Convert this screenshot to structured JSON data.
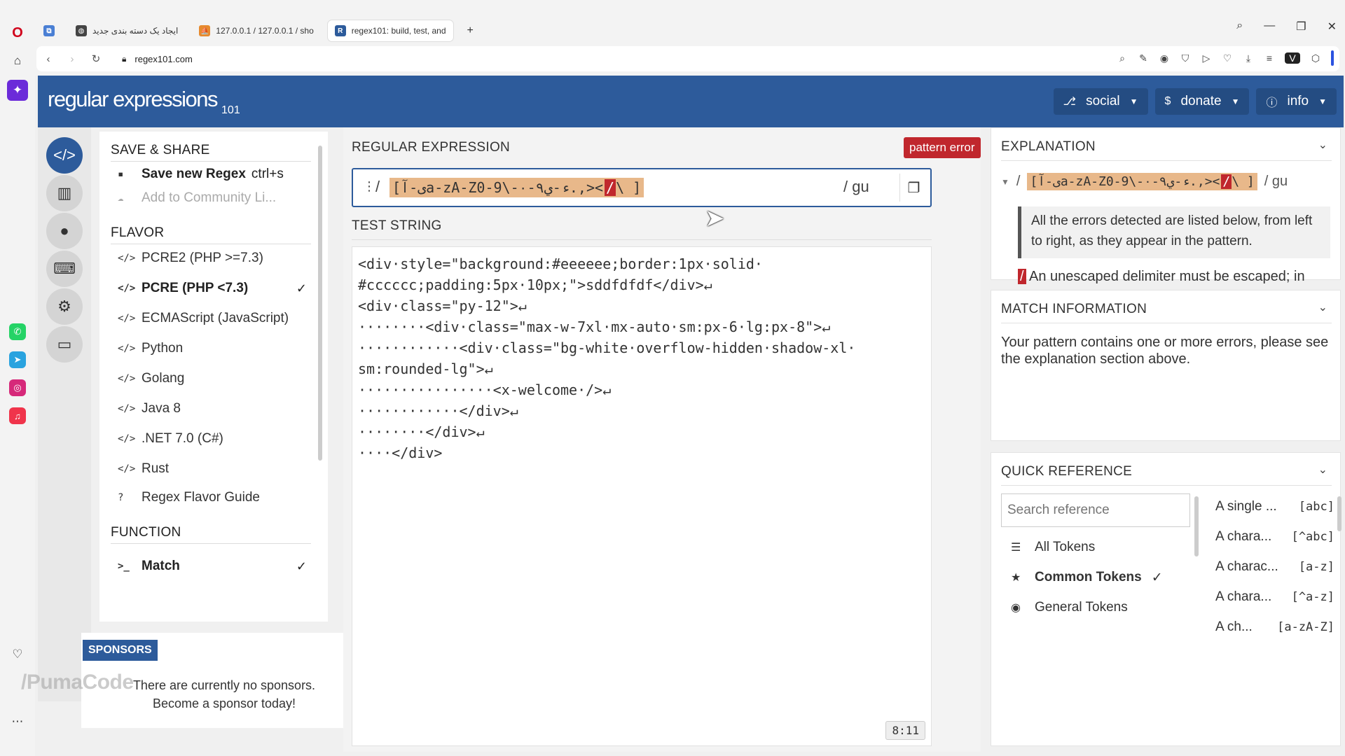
{
  "browser": {
    "tabs": [
      {
        "title": "ایجاد یک دسته بندی جدید",
        "favicon": "globe-icon"
      },
      {
        "title": "127.0.0.1 / 127.0.0.1 / sho",
        "favicon": "phpmyadmin-icon"
      },
      {
        "title": "regex101: build, test, and",
        "favicon": "regex101-icon",
        "active": true
      }
    ],
    "new_tab": "+",
    "url": "regex101.com"
  },
  "header": {
    "logo": "regular expressions",
    "logo_sub": "101",
    "menu": [
      {
        "label": "social",
        "icon": "share-icon"
      },
      {
        "label": "donate",
        "icon": "dollar-icon"
      },
      {
        "label": "info",
        "icon": "info-icon"
      }
    ]
  },
  "left": {
    "save_share_title": "SAVE & SHARE",
    "save_new": "Save new Regex",
    "save_shortcut": "ctrl+s",
    "add_community": "Add to Community Li...",
    "flavor_title": "FLAVOR",
    "flavors": [
      "PCRE2 (PHP >=7.3)",
      "PCRE (PHP <7.3)",
      "ECMAScript (JavaScript)",
      "Python",
      "Golang",
      "Java 8",
      ".NET 7.0 (C#)",
      "Rust"
    ],
    "selected_flavor": "PCRE (PHP <7.3)",
    "flavor_guide": "Regex Flavor Guide",
    "function_title": "FUNCTION",
    "function_match": "Match"
  },
  "sponsors": {
    "tag": "SPONSORS",
    "line1": "There are currently no sponsors.",
    "line2": "Become a sponsor today!"
  },
  "regex": {
    "label": "REGULAR EXPRESSION",
    "error_badge": "pattern error",
    "delimiter": "/",
    "pattern_main": "[ی-آa-zA-Z0-9\\-۰-۹ء-ي.,><",
    "pattern_error": "/",
    "pattern_tail": "\\ ]",
    "flags": "/ gu"
  },
  "test": {
    "label": "TEST STRING",
    "lines": [
      "<div·style=\"background:#eeeeee;border:1px·solid·",
      "#cccccc;padding:5px·10px;\">sddfdfdf</div>↵",
      "<div·class=\"py-12\">↵",
      "········<div·class=\"max-w-7xl·mx-auto·sm:px-6·lg:px-8\">↵",
      "············<div·class=\"bg-white·overflow-hidden·shadow-xl·",
      "sm:rounded-lg\">↵",
      "················<x-welcome·/>↵",
      "············</div>↵",
      "········</div>↵",
      "····</div>"
    ],
    "position": "8:11"
  },
  "explanation": {
    "title": "EXPLANATION",
    "pattern_main": "[ی-آa-zA-Z0-9\\-۰-۹ء-ي.,><",
    "pattern_error": "/",
    "pattern_tail": "\\ ]",
    "flags": "/ gu",
    "quote": "All the errors detected are listed below, from left to right, as they appear in the pattern.",
    "error_mark": "/",
    "error_text": "An unescaped delimiter must be escaped; in most languages with a backslash (",
    "backslash": "\\",
    "error_close": ")"
  },
  "match_info": {
    "title": "MATCH INFORMATION",
    "text": "Your pattern contains one or more errors, please see the explanation section above."
  },
  "quick_ref": {
    "title": "QUICK REFERENCE",
    "search_placeholder": "Search reference",
    "categories": [
      "All Tokens",
      "Common Tokens",
      "General Tokens"
    ],
    "selected_category": "Common Tokens",
    "refs": [
      {
        "desc": "A single ...",
        "token": "[abc]"
      },
      {
        "desc": "A chara...",
        "token": "[^abc]"
      },
      {
        "desc": "A charac...",
        "token": "[a-z]"
      },
      {
        "desc": "A chara...",
        "token": "[^a-z]"
      },
      {
        "desc": "A ch...",
        "token": "[a-zA-Z]"
      }
    ]
  },
  "watermark": "/PumaCode",
  "colors": {
    "brand": "#2d5b9b",
    "error": "#c0272d",
    "highlight": "#e8b88a"
  }
}
